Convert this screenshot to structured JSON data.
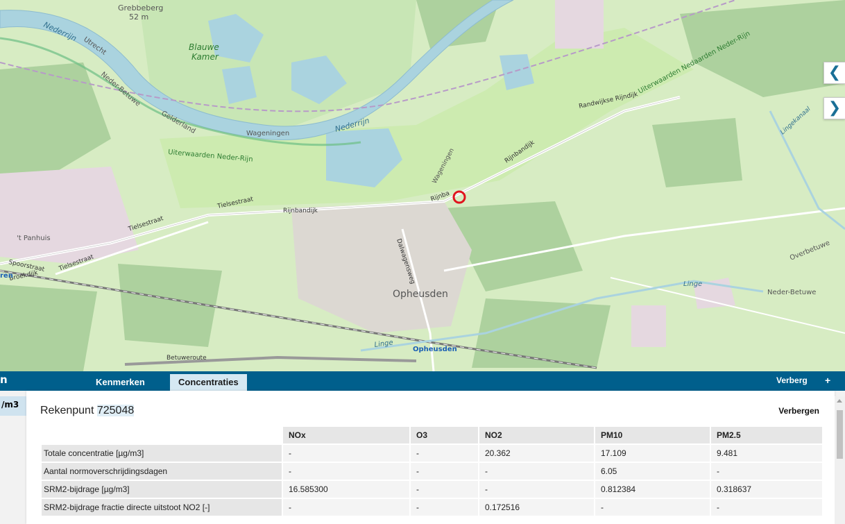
{
  "map": {
    "labels": {
      "grebbeberg": "Grebbeberg",
      "grebbeberg_height": "52 m",
      "nederrijn_nw": "Nederrijn",
      "utrecht": "Utrecht",
      "neder_betuwe_w": "Neder-Betuwe",
      "gelderland": "Gelderland",
      "wageningen_border": "Wageningen",
      "blauwe_kamer_1": "Blauwe",
      "blauwe_kamer_2": "Kamer",
      "nederrijn_river": "Nederrijn",
      "uiterwaarden_w": "Uiterwaarden Neder-Rijn",
      "uiterwaarden_ne": "Uiterwaarden Nedaarden Neder-Rijn",
      "randwijkse": "Randwijkse Rijndijk",
      "rijnbandijk_e": "Rijnbandijk",
      "rijnbandijk_c": "Rijnba",
      "rijnbandijk_w": "Rijnbandijk",
      "wageningen_road": "Wageningen",
      "tielsestraat_n": "Tielsestraat",
      "tielsestraat_s": "Tielsestraat",
      "tielsestraat_w": "Tielsestraat",
      "panhuis": "'t Panhuis",
      "spoorstraat": "Spoorstraat",
      "broekdijk": "Broekdijk",
      "dalwagensweg": "Dalwagensweg",
      "opheusden": "Opheusden",
      "opheusden_station": "Opheusden",
      "linge_s": "Linge",
      "linge_e": "Linge",
      "lingekanaal": "Lingekanaal",
      "overbetuwe": "Overbetuwe",
      "neder_betuwe_e": "Neder-Betuwe",
      "betuweroute": "Betuweroute",
      "edge_ren": "ren"
    },
    "marker_color": "#e0141e",
    "nav_prev_icon": "chevron-left-icon",
    "nav_next_icon": "chevron-right-icon"
  },
  "tabbar": {
    "left_fragment": "n",
    "tabs": [
      {
        "label": "Kenmerken",
        "active": false
      },
      {
        "label": "Concentraties",
        "active": true
      }
    ],
    "hide_label": "Verberg",
    "plus_label": "+"
  },
  "panel": {
    "left_unit_fragment": "/m3",
    "title_prefix": "Rekenpunt",
    "title_number": "725048",
    "hide_label": "Verbergen",
    "columns": [
      "NOx",
      "O3",
      "NO2",
      "PM10",
      "PM2.5"
    ],
    "rows": [
      {
        "label": "Totale concentratie [µg/m3]",
        "values": [
          "-",
          "-",
          "20.362",
          "17.109",
          "9.481"
        ]
      },
      {
        "label": "Aantal normoverschrijdingsdagen",
        "values": [
          "-",
          "-",
          "-",
          "6.05",
          "-"
        ]
      },
      {
        "label": "SRM2-bijdrage [µg/m3]",
        "values": [
          "16.585300",
          "-",
          "-",
          "0.812384",
          "0.318637"
        ]
      },
      {
        "label": "SRM2-bijdrage fractie directe uitstoot NO2 [-]",
        "values": [
          "-",
          "-",
          "0.172516",
          "-",
          "-"
        ]
      }
    ]
  },
  "colors": {
    "header_bar": "#005f8c",
    "active_tab": "#d5e8f2",
    "map_green": "#d7ecc3",
    "water": "#aad3df"
  }
}
